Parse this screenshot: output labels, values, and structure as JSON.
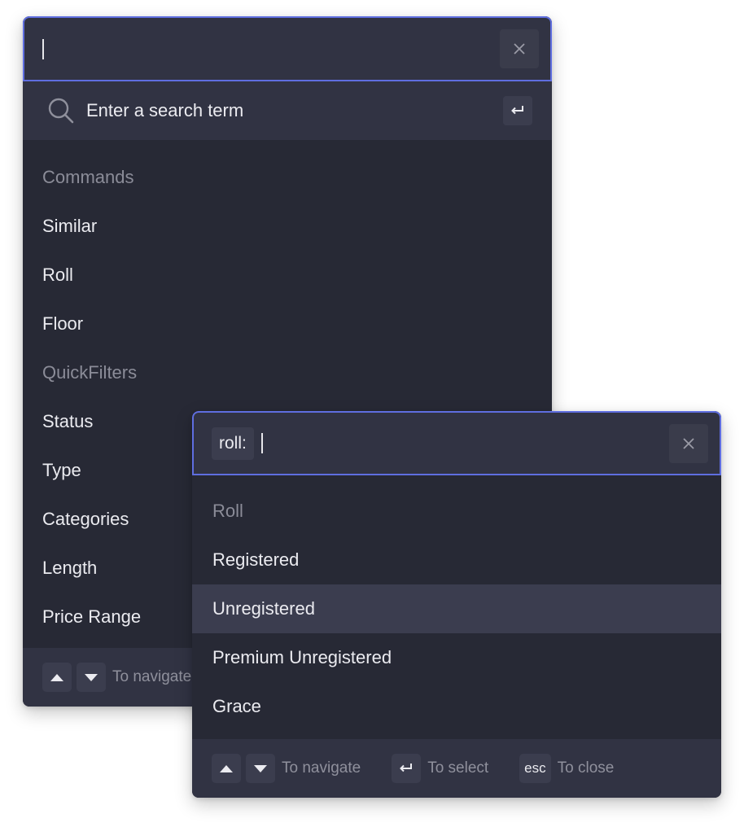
{
  "palette_main": {
    "input": {
      "value": ""
    },
    "search": {
      "placeholder": "Enter a search term"
    },
    "groups": [
      {
        "heading": "Commands",
        "items": [
          "Similar",
          "Roll",
          "Floor"
        ]
      },
      {
        "heading": "QuickFilters",
        "items": [
          "Status",
          "Type",
          "Categories",
          "Length",
          "Price Range"
        ]
      }
    ],
    "footer": {
      "navigate_hint": "To navigate"
    }
  },
  "palette_roll": {
    "input": {
      "chip": "roll:",
      "value": ""
    },
    "heading": "Roll",
    "items": [
      "Registered",
      "Unregistered",
      "Premium Unregistered",
      "Grace"
    ],
    "selected_item": "Unregistered",
    "footer": {
      "navigate_hint": "To navigate",
      "select_hint": "To select",
      "esc_key": "esc",
      "close_hint": "To close"
    }
  },
  "colors": {
    "panel_bg": "#272935",
    "input_bg": "#313343",
    "focus_border": "#5f6ee0",
    "selected_bg": "#3b3d4f",
    "text": "#ebebf0",
    "muted_text": "#8b8c98"
  }
}
